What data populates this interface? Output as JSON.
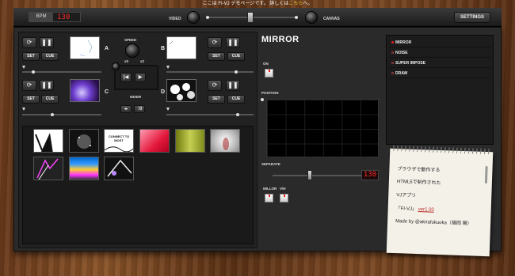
{
  "notice": {
    "before": "ここは FI-VJ デモページです。 詳しくは",
    "link": "こちら",
    "after": "へ。"
  },
  "topbar": {
    "bpm_label": "BPM",
    "bpm_value": "130",
    "video_label": "VIDEO",
    "canvas_label": "CANVAS",
    "settings_label": "SETTINGS"
  },
  "decks": [
    {
      "letter": "A",
      "set": "SET",
      "cue": "CUE"
    },
    {
      "letter": "B",
      "set": "SET",
      "cue": "CUE"
    },
    {
      "letter": "C",
      "set": "SET",
      "cue": "CUE"
    },
    {
      "letter": "D",
      "set": "SET",
      "cue": "CUE"
    }
  ],
  "speed": {
    "label": "SPEED",
    "min": "x0",
    "max": "x2"
  },
  "mixer": {
    "label": "MIXER"
  },
  "effect": {
    "title": "MIRROR",
    "on_label": "ON",
    "position_label": "POSITION",
    "separate_label": "SEPARATE",
    "separate_value": "130",
    "millor_label": "MILLOR",
    "vh_label": "V/H"
  },
  "effects_list": [
    "MIRROR",
    "NOISE",
    "SUPER IMPOSE",
    "DRAW"
  ],
  "note": {
    "line1": "ブラウザで動作する",
    "line2": "HTML5で制作された",
    "line3": "VJアプリ",
    "line4a": "「FI-VJ」",
    "line4b": "ver1.00",
    "line5": "Made by @akirafukuoka（福岡 陽）"
  },
  "library": {
    "item3_text": "CONNECT TO MOST"
  },
  "colors": {
    "accent": "#e02020",
    "bpm": "#ff2a2a"
  }
}
